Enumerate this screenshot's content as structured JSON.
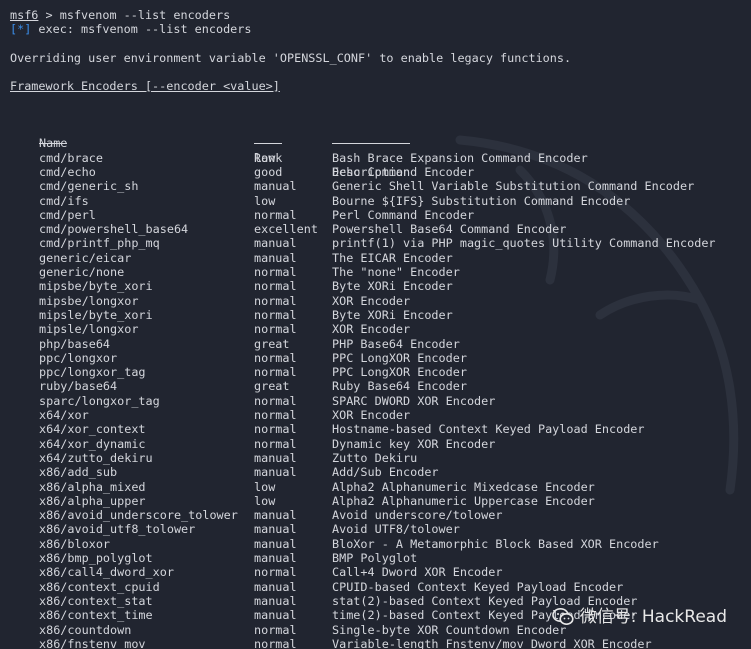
{
  "prompt": {
    "name": "msf6",
    "separator": " > ",
    "command": "msfvenom --list encoders"
  },
  "exec_line": {
    "marker": "[*]",
    "text": " exec: msfvenom --list encoders"
  },
  "notice": "Overriding user environment variable 'OPENSSL_CONF' to enable legacy functions.",
  "section_title": "Framework Encoders [--encoder <value>]",
  "table": {
    "headers": {
      "name": "Name",
      "rank": "Rank",
      "description": "Description"
    },
    "rows": [
      {
        "name": "cmd/brace",
        "rank": "low",
        "description": "Bash Brace Expansion Command Encoder"
      },
      {
        "name": "cmd/echo",
        "rank": "good",
        "description": "Echo Command Encoder"
      },
      {
        "name": "cmd/generic_sh",
        "rank": "manual",
        "description": "Generic Shell Variable Substitution Command Encoder"
      },
      {
        "name": "cmd/ifs",
        "rank": "low",
        "description": "Bourne ${IFS} Substitution Command Encoder"
      },
      {
        "name": "cmd/perl",
        "rank": "normal",
        "description": "Perl Command Encoder"
      },
      {
        "name": "cmd/powershell_base64",
        "rank": "excellent",
        "description": "Powershell Base64 Command Encoder"
      },
      {
        "name": "cmd/printf_php_mq",
        "rank": "manual",
        "description": "printf(1) via PHP magic_quotes Utility Command Encoder"
      },
      {
        "name": "generic/eicar",
        "rank": "manual",
        "description": "The EICAR Encoder"
      },
      {
        "name": "generic/none",
        "rank": "normal",
        "description": "The \"none\" Encoder"
      },
      {
        "name": "mipsbe/byte_xori",
        "rank": "normal",
        "description": "Byte XORi Encoder"
      },
      {
        "name": "mipsbe/longxor",
        "rank": "normal",
        "description": "XOR Encoder"
      },
      {
        "name": "mipsle/byte_xori",
        "rank": "normal",
        "description": "Byte XORi Encoder"
      },
      {
        "name": "mipsle/longxor",
        "rank": "normal",
        "description": "XOR Encoder"
      },
      {
        "name": "php/base64",
        "rank": "great",
        "description": "PHP Base64 Encoder"
      },
      {
        "name": "ppc/longxor",
        "rank": "normal",
        "description": "PPC LongXOR Encoder"
      },
      {
        "name": "ppc/longxor_tag",
        "rank": "normal",
        "description": "PPC LongXOR Encoder"
      },
      {
        "name": "ruby/base64",
        "rank": "great",
        "description": "Ruby Base64 Encoder"
      },
      {
        "name": "sparc/longxor_tag",
        "rank": "normal",
        "description": "SPARC DWORD XOR Encoder"
      },
      {
        "name": "x64/xor",
        "rank": "normal",
        "description": "XOR Encoder"
      },
      {
        "name": "x64/xor_context",
        "rank": "normal",
        "description": "Hostname-based Context Keyed Payload Encoder"
      },
      {
        "name": "x64/xor_dynamic",
        "rank": "normal",
        "description": "Dynamic key XOR Encoder"
      },
      {
        "name": "x64/zutto_dekiru",
        "rank": "manual",
        "description": "Zutto Dekiru"
      },
      {
        "name": "x86/add_sub",
        "rank": "manual",
        "description": "Add/Sub Encoder"
      },
      {
        "name": "x86/alpha_mixed",
        "rank": "low",
        "description": "Alpha2 Alphanumeric Mixedcase Encoder"
      },
      {
        "name": "x86/alpha_upper",
        "rank": "low",
        "description": "Alpha2 Alphanumeric Uppercase Encoder"
      },
      {
        "name": "x86/avoid_underscore_tolower",
        "rank": "manual",
        "description": "Avoid underscore/tolower"
      },
      {
        "name": "x86/avoid_utf8_tolower",
        "rank": "manual",
        "description": "Avoid UTF8/tolower"
      },
      {
        "name": "x86/bloxor",
        "rank": "manual",
        "description": "BloXor - A Metamorphic Block Based XOR Encoder"
      },
      {
        "name": "x86/bmp_polyglot",
        "rank": "manual",
        "description": "BMP Polyglot"
      },
      {
        "name": "x86/call4_dword_xor",
        "rank": "normal",
        "description": "Call+4 Dword XOR Encoder"
      },
      {
        "name": "x86/context_cpuid",
        "rank": "manual",
        "description": "CPUID-based Context Keyed Payload Encoder"
      },
      {
        "name": "x86/context_stat",
        "rank": "manual",
        "description": "stat(2)-based Context Keyed Payload Encoder"
      },
      {
        "name": "x86/context_time",
        "rank": "manual",
        "description": "time(2)-based Context Keyed Payload Encoder"
      },
      {
        "name": "x86/countdown",
        "rank": "normal",
        "description": "Single-byte XOR Countdown Encoder"
      },
      {
        "name": "x86/fnstenv_mov",
        "rank": "normal",
        "description": "Variable-length Fnstenv/mov Dword XOR Encoder"
      }
    ]
  },
  "watermark": {
    "text": "微信号: HackRead",
    "icon": "wechat-icon"
  },
  "colors": {
    "background": "#212530",
    "text": "#d4d6dc",
    "info_marker": "#3b8eea"
  }
}
